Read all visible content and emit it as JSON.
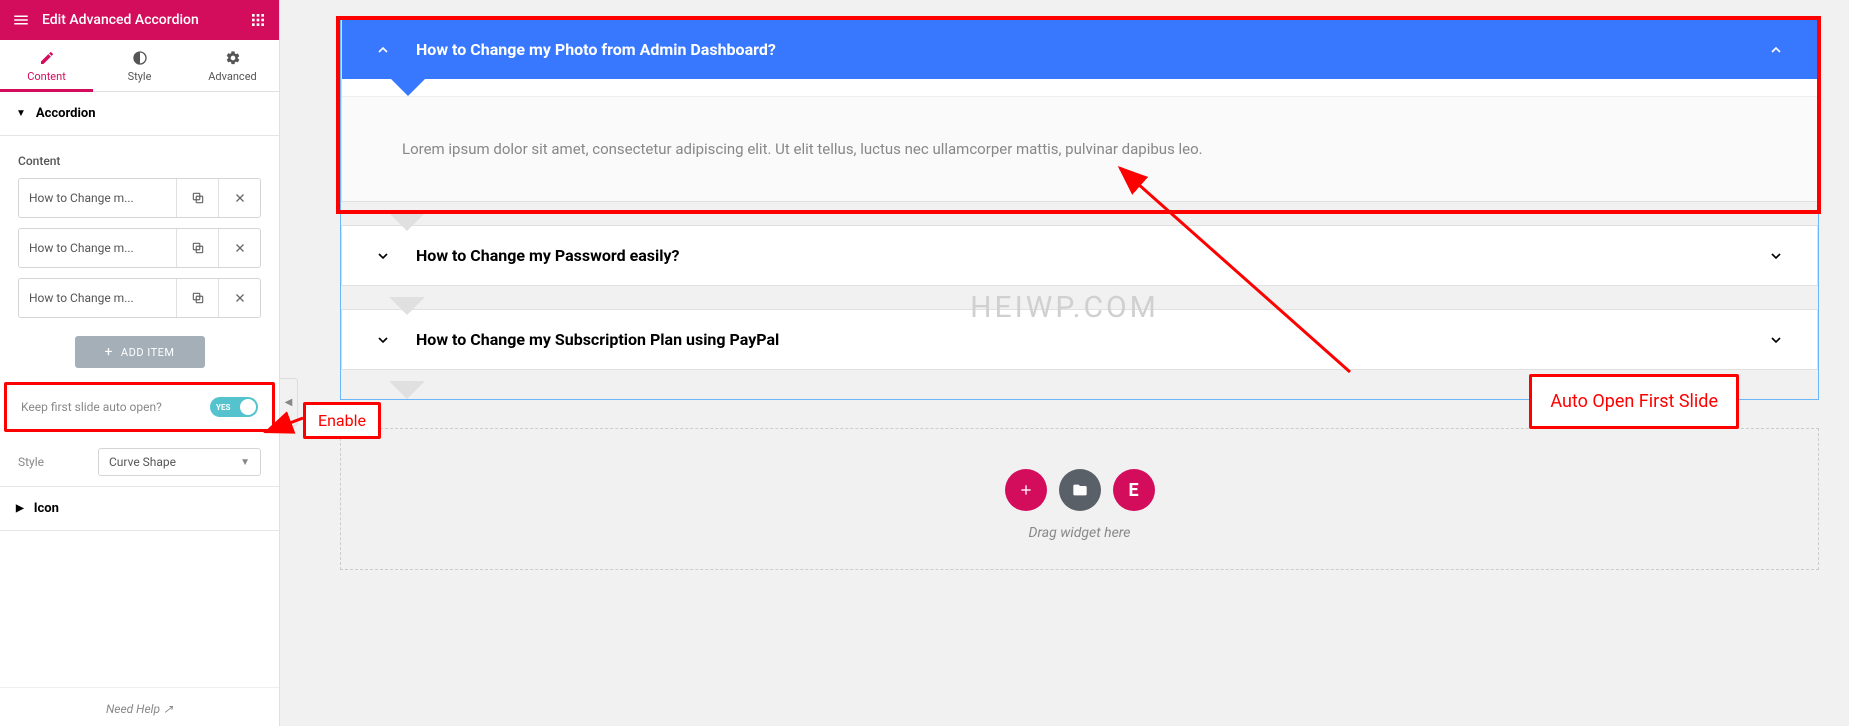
{
  "header": {
    "title": "Edit Advanced Accordion"
  },
  "tabs": {
    "content": "Content",
    "style": "Style",
    "advanced": "Advanced"
  },
  "sections": {
    "accordion": "Accordion",
    "icon": "Icon"
  },
  "controls": {
    "content_label": "Content",
    "items": [
      "How to Change m...",
      "How to Change m...",
      "How to Change m..."
    ],
    "add_item": "ADD ITEM",
    "keep_first_open": "Keep first slide auto open?",
    "toggle_yes": "YES",
    "style_label": "Style",
    "style_value": "Curve Shape"
  },
  "footer": {
    "need_help": "Need Help"
  },
  "preview": {
    "items": [
      {
        "title": "How to Change my Photo from Admin Dashboard?",
        "body": "Lorem ipsum dolor sit amet, consectetur adipiscing elit. Ut elit tellus, luctus nec ullamcorper mattis, pulvinar dapibus leo.",
        "open": true
      },
      {
        "title": "How to Change my Password easily?",
        "open": false
      },
      {
        "title": "How to Change my Subscription Plan using PayPal",
        "open": false
      }
    ],
    "dropzone_text": "Drag widget here"
  },
  "annotations": {
    "enable": "Enable",
    "auto_open": "Auto Open First Slide"
  },
  "watermark": "HEIWP.COM"
}
